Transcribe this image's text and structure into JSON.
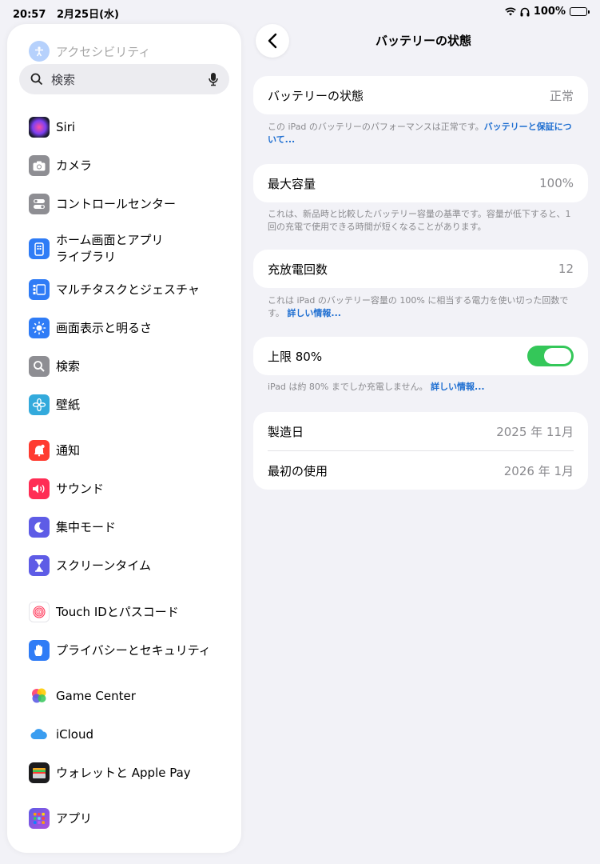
{
  "status_bar": {
    "time": "20:57",
    "date": "2月25日(水)",
    "battery": "100%"
  },
  "sidebar": {
    "faded_item": "アクセシビリティ",
    "search_placeholder": "検索",
    "items": [
      {
        "label": "Siri",
        "icon": "siri-icon",
        "color": "#1b1b2f"
      },
      {
        "label": "カメラ",
        "icon": "camera-icon",
        "color": "#8e8e93"
      },
      {
        "label": "コントロールセンター",
        "icon": "control-center-icon",
        "color": "#8e8e93"
      },
      {
        "label": "ホーム画面とアプリ",
        "label2": "ライブラリ",
        "icon": "home-screen-icon",
        "color": "#2f7cf6"
      },
      {
        "label": "マルチタスクとジェスチャ",
        "icon": "multitask-icon",
        "color": "#2f7cf6"
      },
      {
        "label": "画面表示と明るさ",
        "icon": "brightness-icon",
        "color": "#2f7cf6"
      },
      {
        "label": "検索",
        "icon": "search-app-icon",
        "color": "#8e8e93"
      },
      {
        "label": "壁紙",
        "icon": "wallpaper-icon",
        "color": "#33aadc"
      },
      {
        "label": "通知",
        "icon": "notification-icon",
        "color": "#ff3b30"
      },
      {
        "label": "サウンド",
        "icon": "sound-icon",
        "color": "#ff2d55"
      },
      {
        "label": "集中モード",
        "icon": "focus-icon",
        "color": "#5e5ce6"
      },
      {
        "label": "スクリーンタイム",
        "icon": "screen-time-icon",
        "color": "#5e5ce6"
      },
      {
        "label": "Touch IDとパスコード",
        "icon": "touch-id-icon",
        "color": "#ffffff"
      },
      {
        "label": "プライバシーとセキュリティ",
        "icon": "privacy-icon",
        "color": "#2f7cf6"
      },
      {
        "label": "Game Center",
        "icon": "game-center-icon",
        "color": "#ffffff"
      },
      {
        "label": "iCloud",
        "icon": "icloud-icon",
        "color": "#ffffff"
      },
      {
        "label": "ウォレットと Apple Pay",
        "icon": "wallet-icon",
        "color": "#1c1c1e"
      },
      {
        "label": "アプリ",
        "icon": "apps-icon",
        "color": "#5e5ce6"
      }
    ]
  },
  "main": {
    "title": "バッテリーの状態",
    "health": {
      "label": "バッテリーの状態",
      "value": "正常"
    },
    "health_note": "この iPad のバッテリーのパフォーマンスは正常です。",
    "health_link": "バッテリーと保証について...",
    "capacity": {
      "label": "最大容量",
      "value": "100%"
    },
    "capacity_note": "これは、新品時と比較したバッテリー容量の基準です。容量が低下すると、1回の充電で使用できる時間が短くなることがあります。",
    "cycles": {
      "label": "充放電回数",
      "value": "12"
    },
    "cycles_note": "これは iPad のバッテリー容量の 100% に相当する電力を使い切った回数です。",
    "cycles_link": "詳しい情報...",
    "limit": {
      "label": "上限 80%",
      "on": true
    },
    "limit_note": "iPad は約 80% までしか充電しません。",
    "limit_link": "詳しい情報...",
    "manufacture": {
      "label": "製造日",
      "value": "2025 年 11月"
    },
    "first_use": {
      "label": "最初の使用",
      "value": "2026 年 1月"
    }
  }
}
